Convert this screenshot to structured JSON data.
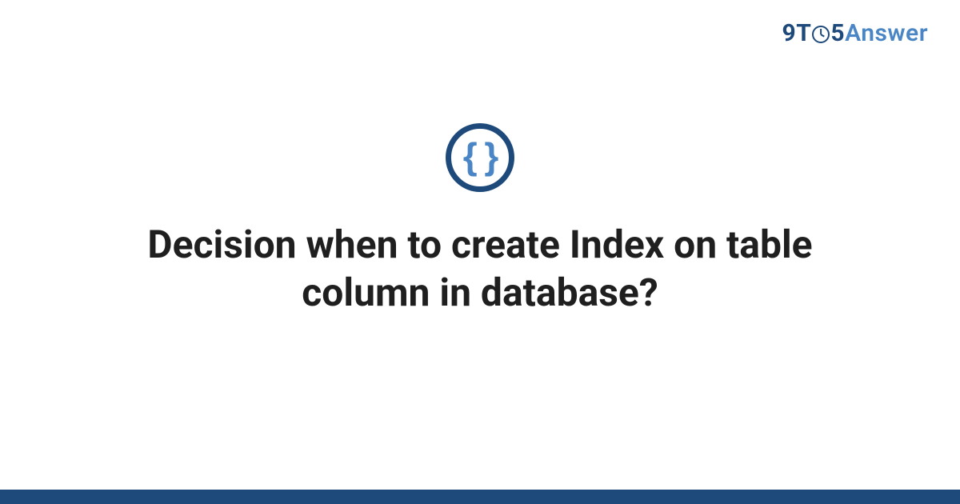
{
  "brand": {
    "part1": "9",
    "part2": "T",
    "part3": "5",
    "part4": "Answer"
  },
  "icon": {
    "glyph": "{ }"
  },
  "main": {
    "title": "Decision when to create Index on table column in database?"
  },
  "colors": {
    "primary": "#1d4a7a",
    "accent": "#4a86c5"
  }
}
